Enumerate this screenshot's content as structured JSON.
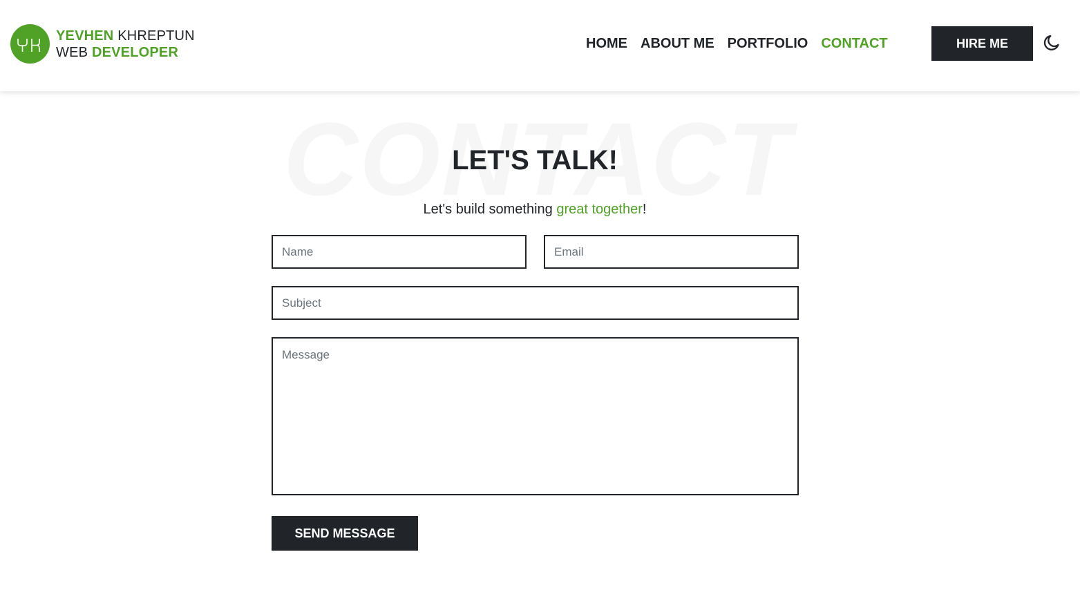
{
  "brand": {
    "first_name": "YEVHEN",
    "last_name": "KHREPTUN",
    "role_prefix": "WEB",
    "role": "DEVELOPER",
    "logo_icon": "yk-monogram-icon"
  },
  "nav": {
    "items": [
      {
        "label": "HOME"
      },
      {
        "label": "ABOUT ME"
      },
      {
        "label": "PORTFOLIO"
      },
      {
        "label": "CONTACT",
        "active": true
      }
    ],
    "hire_label": "HIRE ME",
    "theme_icon": "moon-icon"
  },
  "contact": {
    "watermark": "CONTACT",
    "title": "LET'S TALK!",
    "subtitle_start": "Let's build something ",
    "subtitle_highlight": "great together",
    "subtitle_end": "!",
    "name_placeholder": "Name",
    "email_placeholder": "Email",
    "subject_placeholder": "Subject",
    "message_placeholder": "Message",
    "send_label": "SEND MESSAGE"
  },
  "colors": {
    "accent": "#50a227",
    "dark": "#212529",
    "watermark": "#f6f6f6"
  }
}
